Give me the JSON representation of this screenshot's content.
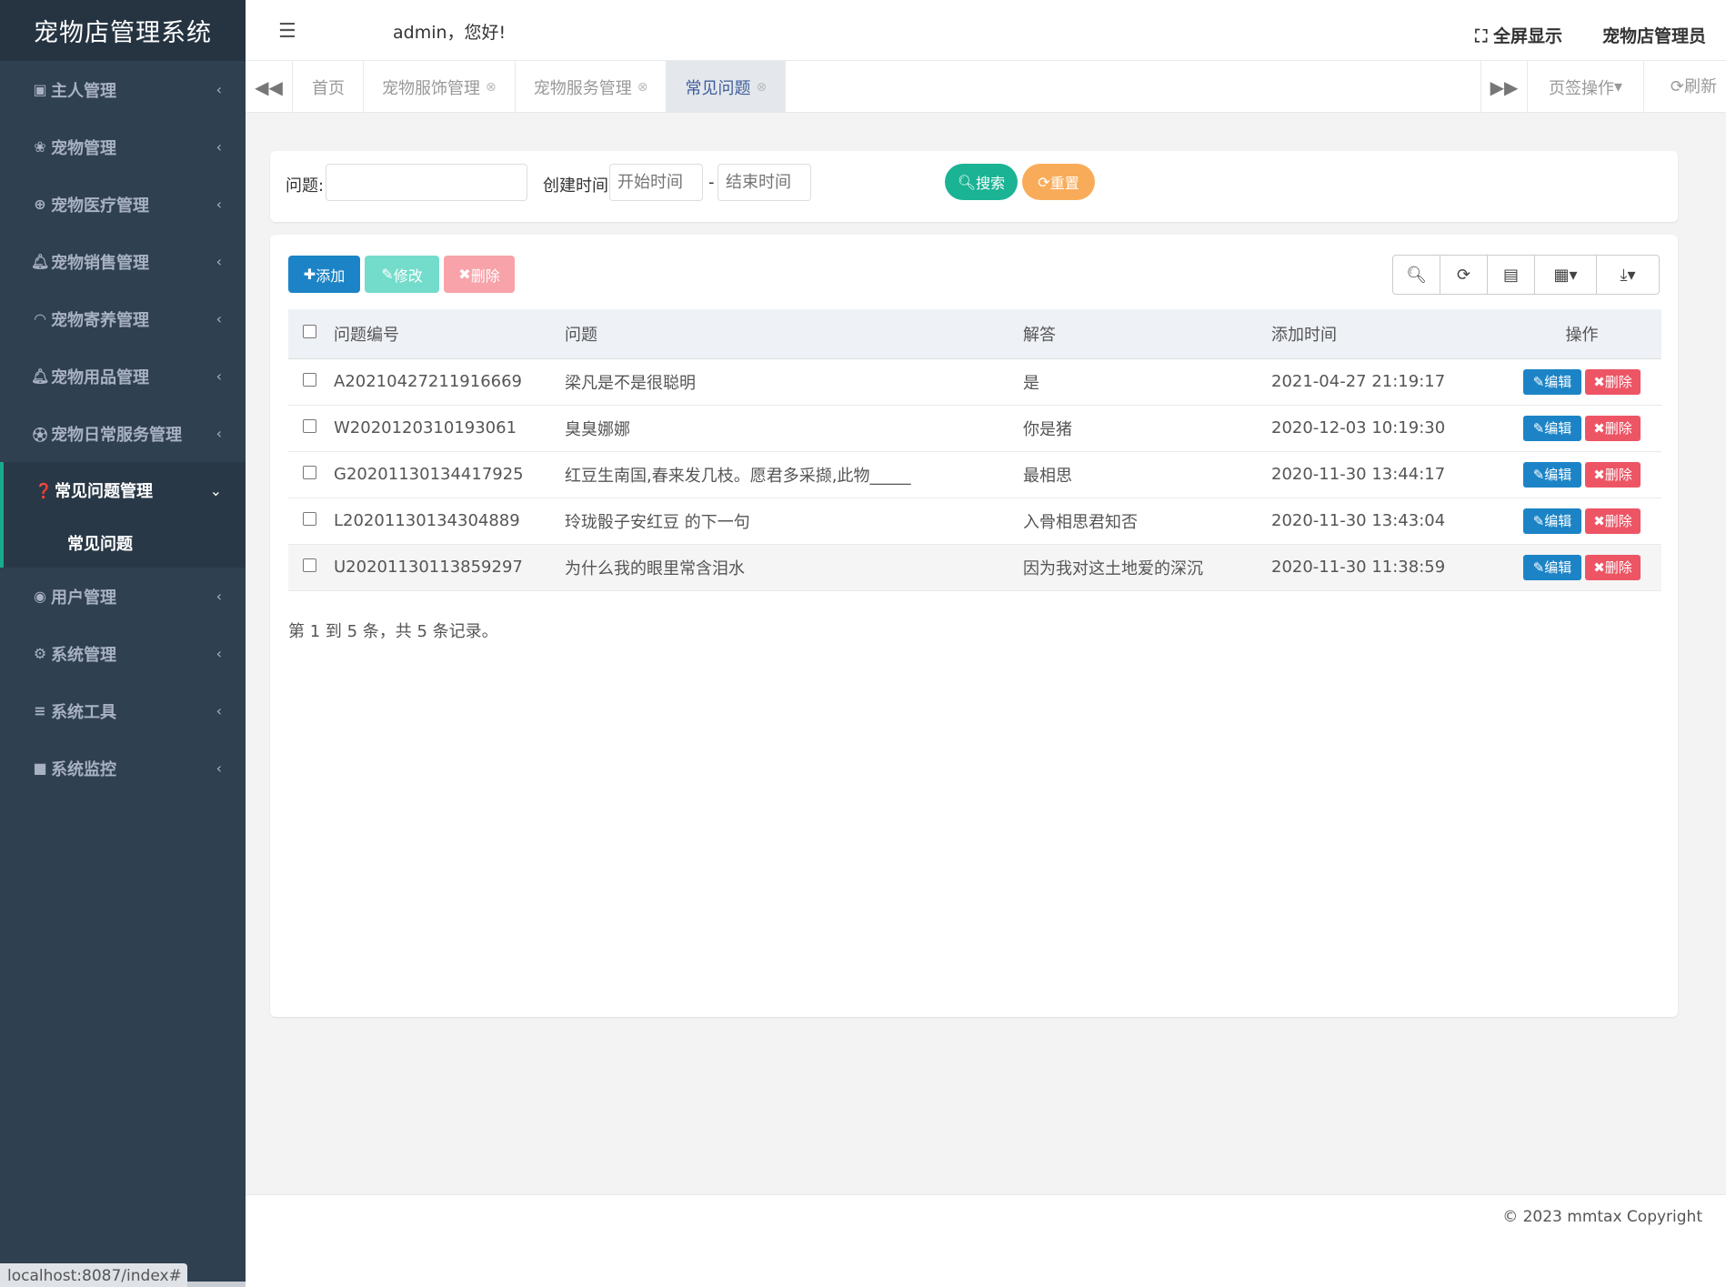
{
  "app": {
    "title": "宠物店管理系统"
  },
  "sidebar": {
    "items": [
      {
        "icon": "id-card-icon",
        "label": "主人管理"
      },
      {
        "icon": "paw-icon",
        "label": "宠物管理"
      },
      {
        "icon": "plus-circle-icon",
        "label": "宠物医疗管理"
      },
      {
        "icon": "bell-icon",
        "label": "宠物销售管理"
      },
      {
        "icon": "wifi-icon",
        "label": "宠物寄养管理"
      },
      {
        "icon": "bell-icon",
        "label": "宠物用品管理"
      },
      {
        "icon": "soccer-ball-icon",
        "label": "宠物日常服务管理"
      }
    ],
    "active": {
      "icon": "question-circle-icon",
      "label": "常见问题管理",
      "sub": "常见问题"
    },
    "items_after": [
      {
        "icon": "user-circle-icon",
        "label": "用户管理"
      },
      {
        "icon": "gear-icon",
        "label": "系统管理"
      },
      {
        "icon": "list-icon",
        "label": "系统工具"
      },
      {
        "icon": "video-camera-icon",
        "label": "系统监控"
      }
    ]
  },
  "header": {
    "welcome": "admin，您好!",
    "fullscreen": "全屏显示",
    "role": "宠物店管理员"
  },
  "tabs": {
    "items": [
      "首页",
      "宠物服饰管理",
      "宠物服务管理",
      "常见问题"
    ],
    "active_index": 3,
    "ops": "页签操作",
    "refresh": "刷新"
  },
  "search": {
    "question_label": "问题:",
    "question_value": "",
    "created_label": "创建时间:",
    "start_placeholder": "开始时间",
    "end_placeholder": "结束时间",
    "dash": "-",
    "search_btn": "搜索",
    "reset_btn": "重置"
  },
  "toolbar": {
    "add": "添加",
    "edit": "修改",
    "delete": "删除"
  },
  "table": {
    "columns": [
      "问题编号",
      "问题",
      "解答",
      "添加时间",
      "操作"
    ],
    "rows": [
      {
        "id": "A20210427211916669",
        "question": "梁凡是不是很聪明",
        "answer": "是",
        "time": "2021-04-27 21:19:17"
      },
      {
        "id": "W2020120310193061",
        "question": "臭臭娜娜",
        "answer": "你是猪",
        "time": "2020-12-03 10:19:30"
      },
      {
        "id": "G20201130134417925",
        "question": "红豆生南国,春来发几枝。愿君多采撷,此物_____",
        "answer": "最相思",
        "time": "2020-11-30 13:44:17"
      },
      {
        "id": "L20201130134304889",
        "question": "玲珑骰子安红豆 的下一句",
        "answer": "入骨相思君知否",
        "time": "2020-11-30 13:43:04"
      },
      {
        "id": "U20201130113859297",
        "question": "为什么我的眼里常含泪水",
        "answer": "因为我对这土地爱的深沉",
        "time": "2020-11-30 11:38:59"
      }
    ],
    "row_edit": "编辑",
    "row_delete": "删除"
  },
  "pagination": "第 1 到 5 条，共 5 条记录。",
  "footer": {
    "copyright": "© 2023 mmtax Copyright"
  },
  "status_url": "localhost:8087/index#"
}
